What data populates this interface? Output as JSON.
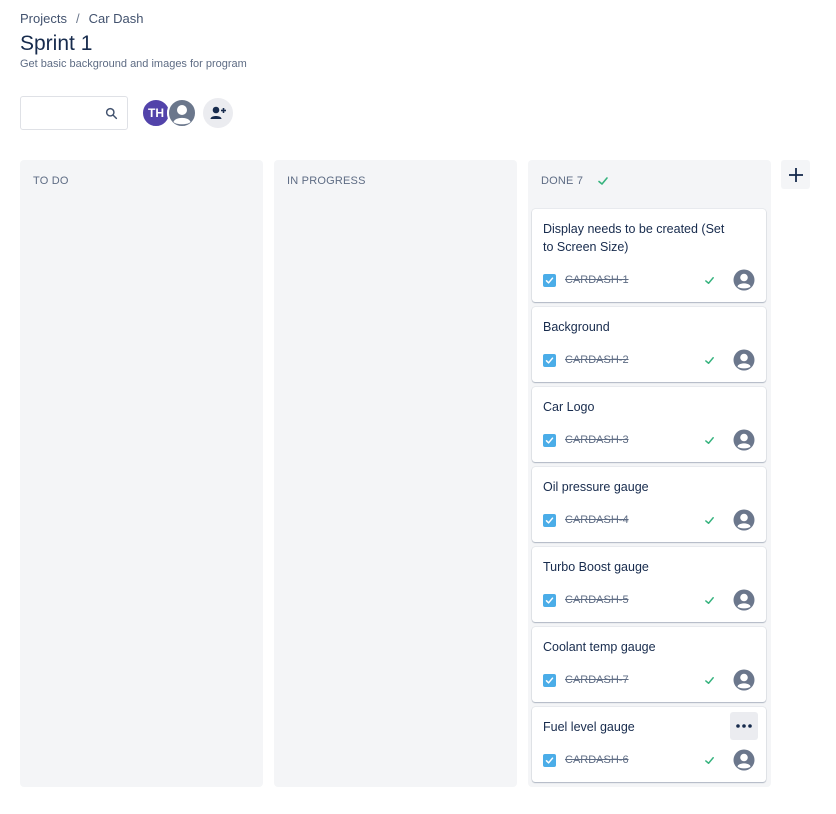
{
  "breadcrumb": {
    "projects": "Projects",
    "separator": "/",
    "project": "Car Dash"
  },
  "page": {
    "title": "Sprint 1",
    "subtitle": "Get basic background and images for program"
  },
  "search": {
    "value": "",
    "placeholder": "",
    "icon": "search-icon"
  },
  "avatars": {
    "user_initials": "TH",
    "user_color": "#5243aa"
  },
  "columns": {
    "todo": {
      "label": "TO DO"
    },
    "in_progress": {
      "label": "IN PROGRESS"
    },
    "done": {
      "label": "DONE 7"
    }
  },
  "colors": {
    "accent": "#0052cc",
    "done_green": "#36b37e",
    "task_blue": "#4bade8",
    "column_bg": "#f4f5f7"
  },
  "cards": [
    {
      "summary": "Display needs to be created (Set to Screen Size)",
      "key": "CARDASH-1"
    },
    {
      "summary": "Background",
      "key": "CARDASH-2"
    },
    {
      "summary": "Car Logo",
      "key": "CARDASH-3"
    },
    {
      "summary": "Oil pressure gauge",
      "key": "CARDASH-4"
    },
    {
      "summary": "Turbo Boost gauge",
      "key": "CARDASH-5"
    },
    {
      "summary": "Coolant temp gauge",
      "key": "CARDASH-7"
    },
    {
      "summary": "Fuel level gauge",
      "key": "CARDASH-6"
    }
  ]
}
